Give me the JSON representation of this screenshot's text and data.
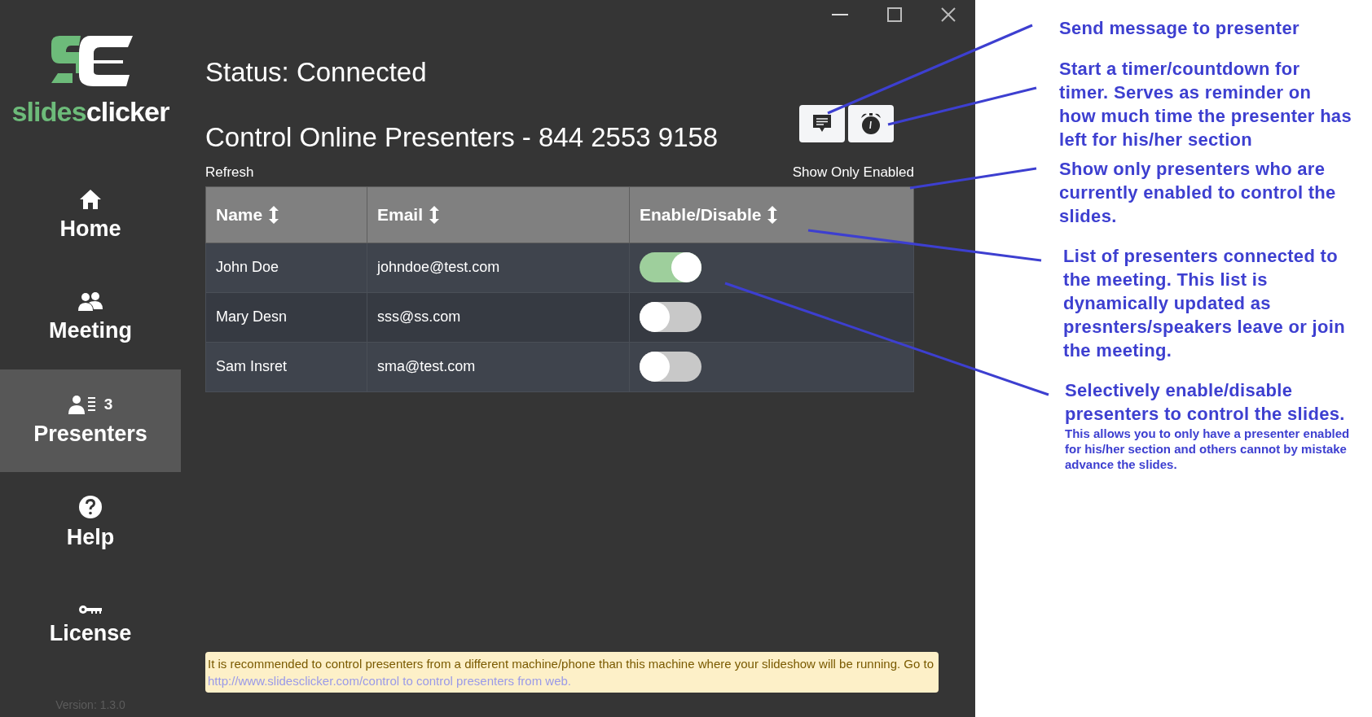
{
  "logo": {
    "parts": [
      "slides",
      "clicker"
    ]
  },
  "sidebar": {
    "items": [
      {
        "label": "Home",
        "selected": false
      },
      {
        "label": "Meeting",
        "selected": false
      },
      {
        "label": "Presenters",
        "badge": "3",
        "selected": true
      },
      {
        "label": "Help",
        "selected": false
      },
      {
        "label": "License",
        "selected": false
      }
    ],
    "version": "Version: 1.3.0"
  },
  "status": "Status: Connected",
  "heading": "Control Online Presenters - 844 2553 9158",
  "refresh": "Refresh",
  "filter": "Show Only Enabled",
  "table": {
    "columns": [
      "Name",
      "Email",
      "Enable/Disable"
    ],
    "rows": [
      {
        "name": "John Doe",
        "email": "johndoe@test.com",
        "enabled": true
      },
      {
        "name": "Mary Desn",
        "email": "sss@ss.com",
        "enabled": false
      },
      {
        "name": "Sam Insret",
        "email": "sma@test.com",
        "enabled": false
      }
    ]
  },
  "notice": {
    "text": "It is recommended to control presenters from a different machine/phone than this machine where your slideshow will be running. Go to ",
    "link": "http://www.slidesclicker.com/control to control presenters from web."
  },
  "annotations": [
    {
      "text": "Send message to presenter"
    },
    {
      "text": "Start a timer/countdown for timer. Serves as reminder on how much time the presenter has left for his/her section"
    },
    {
      "text": "Show only presenters who are currently enabled to control the slides."
    },
    {
      "text": "List of presenters connected to the meeting. This list is dynamically updated as presnters/speakers leave or join the meeting."
    },
    {
      "text": "Selectively enable/disable presenters to control the slides.",
      "note": "This allows you to only have a presenter enabled for his/her section and others cannot by mistake advance the slides."
    }
  ]
}
